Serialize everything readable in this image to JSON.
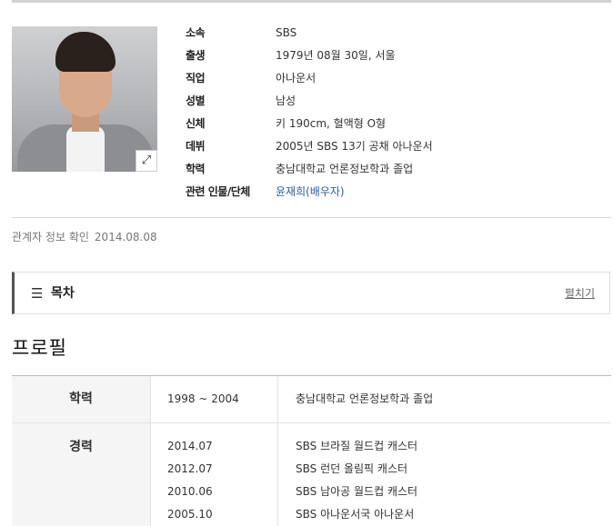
{
  "profile": {
    "photo_alt": "person-photo",
    "expand_icon": "expand-icon",
    "info": [
      {
        "label": "소속",
        "value": "SBS"
      },
      {
        "label": "출생",
        "value": "1979년 08월 30일, 서울"
      },
      {
        "label": "직업",
        "value": "아나운서"
      },
      {
        "label": "성별",
        "value": "남성"
      },
      {
        "label": "신체",
        "value": "키 190cm, 혈액형 O형"
      },
      {
        "label": "데뷔",
        "value": "2005년 SBS 13기 공채 아나운서"
      },
      {
        "label": "학력",
        "value": "충남대학교 언론정보학과 졸업"
      },
      {
        "label": "관련 인물/단체",
        "value": "윤재희(배우자)"
      }
    ]
  },
  "confirm": {
    "label": "관계자 정보 확인",
    "date": "2014.08.08"
  },
  "toc": {
    "icon": "list-icon",
    "title": "목차",
    "toggle": "펼치기"
  },
  "section": {
    "title": "프로필"
  },
  "table": {
    "education": {
      "header": "학력",
      "rows": [
        {
          "year": "1998 ~ 2004",
          "desc": "충남대학교 언론정보학과 졸업"
        }
      ]
    },
    "career": {
      "header": "경력",
      "rows": [
        {
          "year": "2014.07",
          "desc": "SBS 브라질 월드컵 캐스터"
        },
        {
          "year": "2012.07",
          "desc": "SBS 런던 올림픽 캐스터"
        },
        {
          "year": "2010.06",
          "desc": "SBS 남아공 월드컵 캐스터"
        },
        {
          "year": "2005.10",
          "desc": "SBS 아나운서국 아나운서"
        }
      ]
    }
  },
  "colors": {
    "link": "#2b5aa3",
    "toc_accent": "#555555"
  }
}
